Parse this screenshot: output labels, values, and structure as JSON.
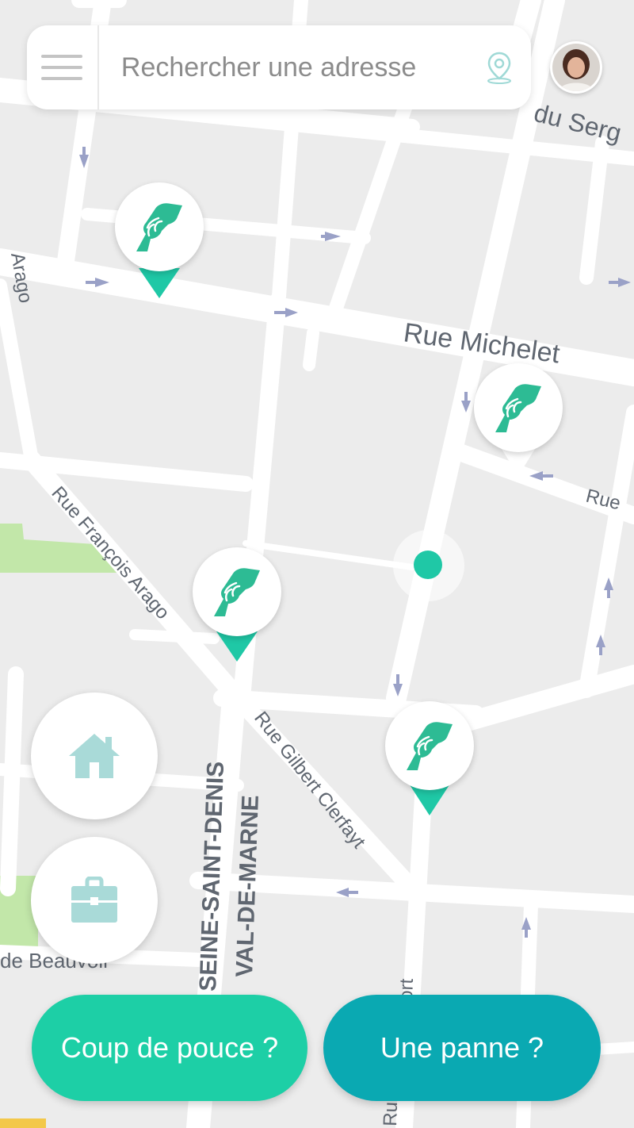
{
  "search": {
    "placeholder": "Rechercher une adresse"
  },
  "map": {
    "street_labels": {
      "rue_du_serg": "du Serg",
      "rue_michelet": "Rue Michelet",
      "rue_partial_right": "Rue",
      "rue_arago_left": "Arago",
      "rue_francois_arago": "Rue François Arago",
      "rue_gilbert_clerfayt": "Rue Gilbert Clerfayt",
      "seine_saint_denis": "SEINE-SAINT-DENIS",
      "val_de_marne": "VAL-DE-MARNE",
      "de_beauvoir": "de Beauvoir",
      "rue_partial_bottom": "Ru",
      "rue_partial_bottom_suffix": "ort"
    },
    "marker_count": 5,
    "colors": {
      "background": "#ececec",
      "road": "#ffffff",
      "park": "#bfe6a6",
      "arrow": "#9aa1c7"
    }
  },
  "buttons": {
    "coup_de_pouce": "Coup de pouce ?",
    "panne": "Une panne ?"
  },
  "icons": {
    "menu": "hamburger-menu-icon",
    "location": "location-pin-icon",
    "home": "home-icon",
    "work": "briefcase-icon",
    "marker": "helping-hand-icon"
  },
  "colors": {
    "accent_green": "#1dcfa6",
    "accent_teal": "#0aa9b2",
    "icon_light": "#a9dad8"
  }
}
